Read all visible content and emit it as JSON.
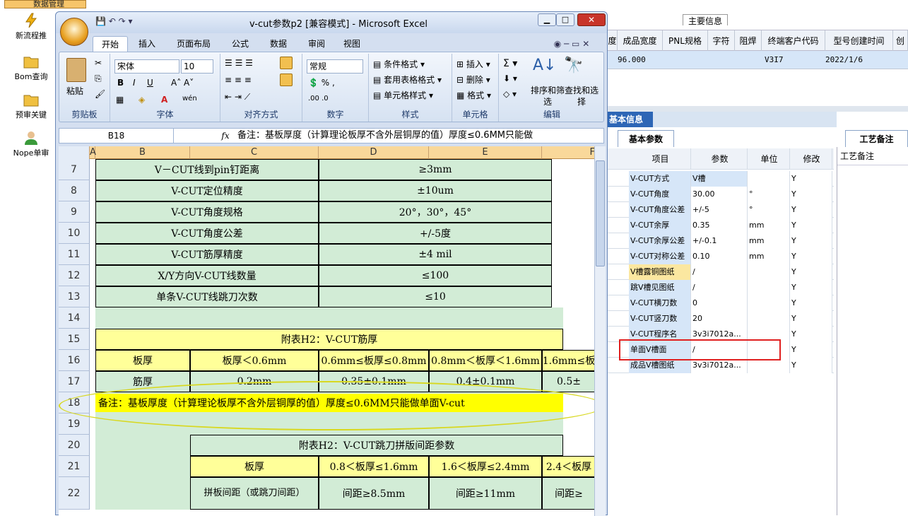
{
  "nav": {
    "tab_label": "数据管理",
    "items": [
      {
        "label": "新流程推",
        "icon": "lightning-icon"
      },
      {
        "label": "Bom查询",
        "icon": "folder-icon"
      },
      {
        "label": "预审关键",
        "icon": "folder-icon"
      },
      {
        "label": "Nope单审",
        "icon": "user-icon"
      }
    ]
  },
  "top_header": {
    "group_label": "主要信息",
    "columns": [
      "度",
      "成品宽度",
      "PNL规格",
      "字符",
      "阻焊",
      "终端客户代码",
      "型号创建时间",
      "创"
    ],
    "row": [
      "",
      "96.000",
      "",
      "",
      "",
      "V3I7",
      "2022/1/6",
      ""
    ]
  },
  "basic_info": {
    "title": "基本信息",
    "tab_basic": "基本参数",
    "tab_craft": "工艺备注",
    "craft_header": "工艺备注",
    "columns": [
      "项目",
      "参数",
      "单位",
      "修改"
    ],
    "rows": [
      {
        "item": "V-CUT方式",
        "param": "V槽",
        "unit": "",
        "mod": "Y"
      },
      {
        "item": "V-CUT角度",
        "param": "30.00",
        "unit": "°",
        "mod": "Y"
      },
      {
        "item": "V-CUT角度公差",
        "param": "+/-5",
        "unit": "°",
        "mod": "Y"
      },
      {
        "item": "V-CUT余厚",
        "param": "0.35",
        "unit": "mm",
        "mod": "Y"
      },
      {
        "item": "V-CUT余厚公差",
        "param": "+/-0.1",
        "unit": "mm",
        "mod": "Y"
      },
      {
        "item": "V-CUT对称公差",
        "param": "0.10",
        "unit": "mm",
        "mod": "Y"
      },
      {
        "item": "V槽露铜图纸",
        "param": "/",
        "unit": "",
        "mod": "Y"
      },
      {
        "item": "跳V槽见图纸",
        "param": "/",
        "unit": "",
        "mod": "Y"
      },
      {
        "item": "V-CUT横刀数",
        "param": "0",
        "unit": "",
        "mod": "Y"
      },
      {
        "item": "V-CUT竖刀数",
        "param": "20",
        "unit": "",
        "mod": "Y"
      },
      {
        "item": "V-CUT程序名",
        "param": "3v3i7012a...",
        "unit": "",
        "mod": "Y"
      },
      {
        "item": "单面V槽面",
        "param": "/",
        "unit": "",
        "mod": "Y"
      },
      {
        "item": "成品V槽图纸",
        "param": "3v3i7012a...",
        "unit": "",
        "mod": "Y"
      }
    ]
  },
  "excel": {
    "title": "v-cut参数p2  [兼容模式] - Microsoft Excel",
    "tabs": [
      "开始",
      "插入",
      "页面布局",
      "公式",
      "数据",
      "审阅",
      "视图"
    ],
    "ribbon": {
      "paste": "粘贴",
      "font_name": "宋体",
      "font_size": "10",
      "number_format": "常规",
      "cond_format": "条件格式",
      "table_format": "套用表格格式",
      "cell_style": "单元格样式",
      "insert": "插入",
      "delete": "删除",
      "format": "格式",
      "sort_filter": "排序和筛选",
      "find_select": "查找和选择",
      "groups": [
        "剪贴板",
        "字体",
        "对齐方式",
        "数字",
        "样式",
        "单元格",
        "编辑"
      ]
    },
    "name_box": "B18",
    "formula": "备注：基板厚度（计算理论板厚不含外层铜厚的值）厚度≤0.6MM只能做",
    "columns": [
      "A",
      "B",
      "C",
      "D",
      "E",
      "F"
    ],
    "rows": [
      {
        "num": "7",
        "label": "V－CUT线到pin钉距离",
        "value": "≥3mm"
      },
      {
        "num": "8",
        "label": "V-CUT定位精度",
        "value": "±10um"
      },
      {
        "num": "9",
        "label": "V-CUT角度规格",
        "value": "20°，30°，45°"
      },
      {
        "num": "10",
        "label": "V-CUT角度公差",
        "value": "+/-5度"
      },
      {
        "num": "11",
        "label": "V-CUT筋厚精度",
        "value": "±4 mil"
      },
      {
        "num": "12",
        "label": "X/Y方向V-CUT线数量",
        "value": "≤100"
      },
      {
        "num": "13",
        "label": "单条V-CUT线跳刀次数",
        "value": "≤10"
      }
    ],
    "row_numbers": [
      "14",
      "15",
      "16",
      "17",
      "18",
      "19",
      "20",
      "21",
      "22"
    ],
    "h2_title": "附表H2：V-CUT筋厚",
    "h2_headers": [
      "板厚",
      "板厚＜0.6mm",
      "0.6mm≤板厚≤0.8mm",
      "0.8mm＜板厚＜1.6mm",
      "1.6mm≤板"
    ],
    "h2_values": [
      "筋厚",
      "0.2mm",
      "0.35±0.1mm",
      "0.4±0.1mm",
      "0.5±"
    ],
    "note": "备注：基板厚度（计算理论板厚不含外层铜厚的值）厚度≤0.6MM只能做单面V-cut",
    "h2b_title": "附表H2：V-CUT跳刀拼版间距参数",
    "h2b_headers": [
      "板厚",
      "0.8＜板厚≤1.6mm",
      "1.6＜板厚≤2.4mm",
      "2.4＜板厚"
    ],
    "h2b_values": [
      "拼板间距（或跳刀间距）",
      "间距≥8.5mm",
      "间距≥11mm",
      "间距≥"
    ]
  }
}
